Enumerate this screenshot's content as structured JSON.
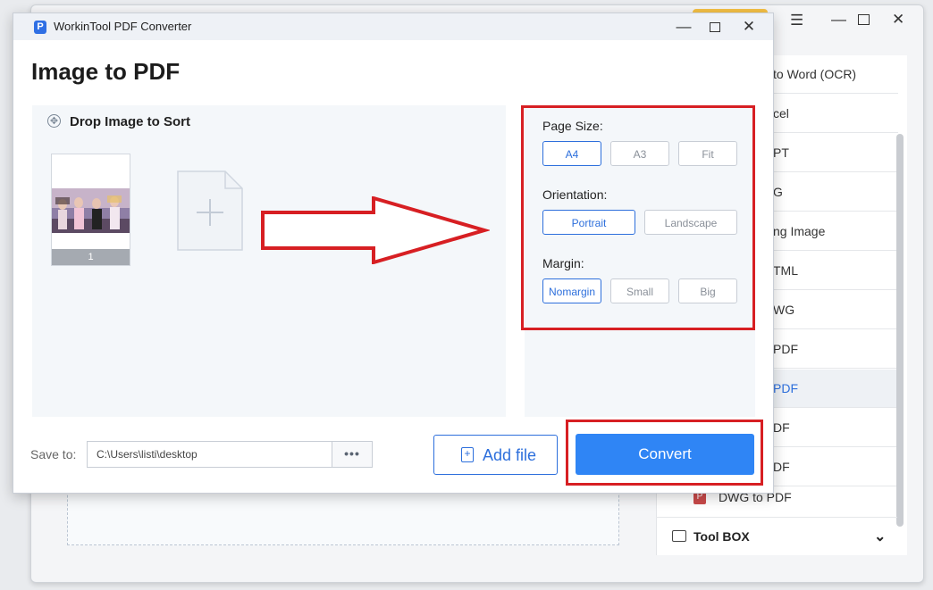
{
  "background": {
    "sidebar_items": [
      {
        "label": "to Word (OCR)"
      },
      {
        "label": "cel"
      },
      {
        "label": "PT"
      },
      {
        "label": "G"
      },
      {
        "label": "ng Image"
      },
      {
        "label": "TML"
      },
      {
        "label": "WG"
      },
      {
        "label": "PDF"
      },
      {
        "label": "PDF"
      },
      {
        "label": "DF"
      },
      {
        "label": "DF"
      }
    ],
    "active_item_index": 8,
    "dwg_item": {
      "badge": "P",
      "label": "DWG to PDF"
    },
    "toolbox_label": "Tool BOX"
  },
  "dialog": {
    "app_logo": "P",
    "app_title": "WorkinTool PDF Converter",
    "page_title": "Image to PDF",
    "drop_label": "Drop Image to Sort",
    "thumbnail": {
      "page_number": "1"
    },
    "options": {
      "page_size": {
        "label": "Page Size:",
        "options": [
          "A4",
          "A3",
          "Fit"
        ],
        "selected": "A4"
      },
      "orientation": {
        "label": "Orientation:",
        "options": [
          "Portrait",
          "Landscape"
        ],
        "selected": "Portrait"
      },
      "margin": {
        "label": "Margin:",
        "options": [
          "Nomargin",
          "Small",
          "Big"
        ],
        "selected": "Nomargin"
      }
    },
    "save_to": {
      "label": "Save to:",
      "path": "C:\\Users\\listi\\desktop",
      "browse_label": "•••"
    },
    "add_file_label": "Add file",
    "convert_label": "Convert"
  },
  "colors": {
    "accent": "#2f85f5",
    "annotation_red": "#d71f23",
    "logo_blue": "#2f6fe4"
  }
}
